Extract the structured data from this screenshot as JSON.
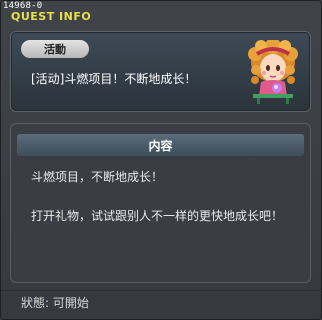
{
  "window": {
    "id": "14968-0",
    "title": "QUEST INFO"
  },
  "quest": {
    "category": "活動",
    "name": "[活动]斗燃项目！不断地成长！"
  },
  "content": {
    "header": "内容",
    "lines": [
      "斗燃项目，不断地成长！",
      "打开礼物，试试跟别人不一样的更快地成长吧！"
    ]
  },
  "status": {
    "text": "狀態: 可開始"
  },
  "colors": {
    "title": "#e8e04a",
    "panel_header": "#4d5f6b"
  },
  "icons": {
    "portrait": "npc-girl-portrait"
  }
}
